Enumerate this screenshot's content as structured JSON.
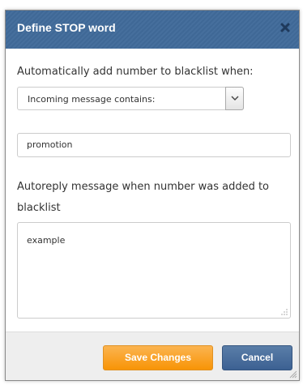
{
  "dialog": {
    "title": "Define STOP word",
    "close_icon": "close-icon"
  },
  "form": {
    "rule_label": "Automatically add number to blacklist when:",
    "condition_select": {
      "selected": "Incoming message contains:"
    },
    "keyword_input": {
      "value": "promotion"
    },
    "autoreply_label": "Autoreply message when number was added to blacklist",
    "autoreply_textarea": {
      "value": "example"
    }
  },
  "footer": {
    "save_label": "Save Changes",
    "cancel_label": "Cancel"
  },
  "colors": {
    "header": "#3f6896",
    "save_button": "#f89406",
    "cancel_button": "#3c6192"
  }
}
